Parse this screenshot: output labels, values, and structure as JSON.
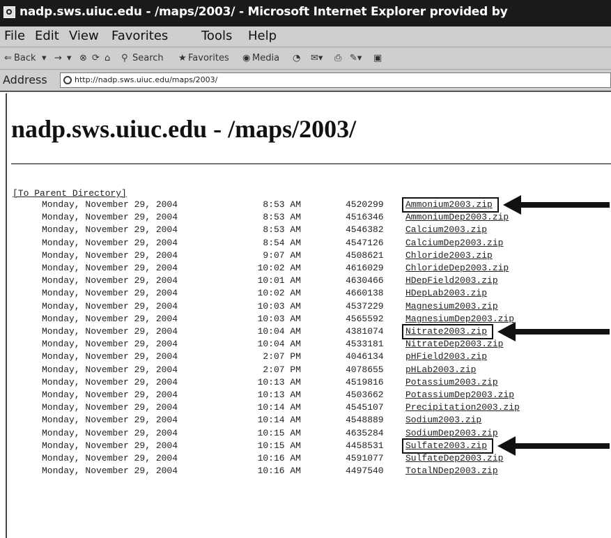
{
  "window": {
    "title": "nadp.sws.uiuc.edu - /maps/2003/ - Microsoft Internet Explorer provided by"
  },
  "menubar": [
    "File",
    "Edit",
    "View",
    "Favorites",
    "Tools",
    "Help"
  ],
  "toolbar": {
    "back_label": "Back",
    "search_label": "Search",
    "favorites_label": "Favorites",
    "media_label": "Media"
  },
  "address": {
    "label": "Address",
    "value": "http://nadp.sws.uiuc.edu/maps/2003/"
  },
  "page": {
    "title": "nadp.sws.uiuc.edu - /maps/2003/",
    "parent_link": "[To Parent Directory]"
  },
  "files": [
    {
      "date": "Monday, November 29, 2004",
      "time": "8:53 AM",
      "size": "4520299",
      "name": "Ammonium2003.zip",
      "highlighted": true
    },
    {
      "date": "Monday, November 29, 2004",
      "time": "8:53 AM",
      "size": "4516346",
      "name": "AmmoniumDep2003.zip",
      "highlighted": false
    },
    {
      "date": "Monday, November 29, 2004",
      "time": "8:53 AM",
      "size": "4546382",
      "name": "Calcium2003.zip",
      "highlighted": false
    },
    {
      "date": "Monday, November 29, 2004",
      "time": "8:54 AM",
      "size": "4547126",
      "name": "CalciumDep2003.zip",
      "highlighted": false
    },
    {
      "date": "Monday, November 29, 2004",
      "time": "9:07 AM",
      "size": "4508621",
      "name": "Chloride2003.zip",
      "highlighted": false
    },
    {
      "date": "Monday, November 29, 2004",
      "time": "10:02 AM",
      "size": "4616029",
      "name": "ChlorideDep2003.zip",
      "highlighted": false
    },
    {
      "date": "Monday, November 29, 2004",
      "time": "10:01 AM",
      "size": "4630466",
      "name": "HDepField2003.zip",
      "highlighted": false
    },
    {
      "date": "Monday, November 29, 2004",
      "time": "10:02 AM",
      "size": "4660138",
      "name": "HDepLab2003.zip",
      "highlighted": false
    },
    {
      "date": "Monday, November 29, 2004",
      "time": "10:03 AM",
      "size": "4537229",
      "name": "Magnesium2003.zip",
      "highlighted": false
    },
    {
      "date": "Monday, November 29, 2004",
      "time": "10:03 AM",
      "size": "4565592",
      "name": "MagnesiumDep2003.zip",
      "highlighted": false
    },
    {
      "date": "Monday, November 29, 2004",
      "time": "10:04 AM",
      "size": "4381074",
      "name": "Nitrate2003.zip",
      "highlighted": true
    },
    {
      "date": "Monday, November 29, 2004",
      "time": "10:04 AM",
      "size": "4533181",
      "name": "NitrateDep2003.zip",
      "highlighted": false
    },
    {
      "date": "Monday, November 29, 2004",
      "time": "2:07 PM",
      "size": "4046134",
      "name": "pHField2003.zip",
      "highlighted": false
    },
    {
      "date": "Monday, November 29, 2004",
      "time": "2:07 PM",
      "size": "4078655",
      "name": "pHLab2003.zip",
      "highlighted": false
    },
    {
      "date": "Monday, November 29, 2004",
      "time": "10:13 AM",
      "size": "4519816",
      "name": "Potassium2003.zip",
      "highlighted": false
    },
    {
      "date": "Monday, November 29, 2004",
      "time": "10:13 AM",
      "size": "4503662",
      "name": "PotassiumDep2003.zip",
      "highlighted": false
    },
    {
      "date": "Monday, November 29, 2004",
      "time": "10:14 AM",
      "size": "4545107",
      "name": "Precipitation2003.zip",
      "highlighted": false
    },
    {
      "date": "Monday, November 29, 2004",
      "time": "10:14 AM",
      "size": "4548889",
      "name": "Sodium2003.zip",
      "highlighted": false
    },
    {
      "date": "Monday, November 29, 2004",
      "time": "10:15 AM",
      "size": "4635284",
      "name": "SodiumDep2003.zip",
      "highlighted": false
    },
    {
      "date": "Monday, November 29, 2004",
      "time": "10:15 AM",
      "size": "4458531",
      "name": "Sulfate2003.zip",
      "highlighted": true
    },
    {
      "date": "Monday, November 29, 2004",
      "time": "10:16 AM",
      "size": "4591077",
      "name": "SulfateDep2003.zip",
      "highlighted": false
    },
    {
      "date": "Monday, November 29, 2004",
      "time": "10:16 AM",
      "size": "4497540",
      "name": "TotalNDep2003.zip",
      "highlighted": false
    }
  ]
}
